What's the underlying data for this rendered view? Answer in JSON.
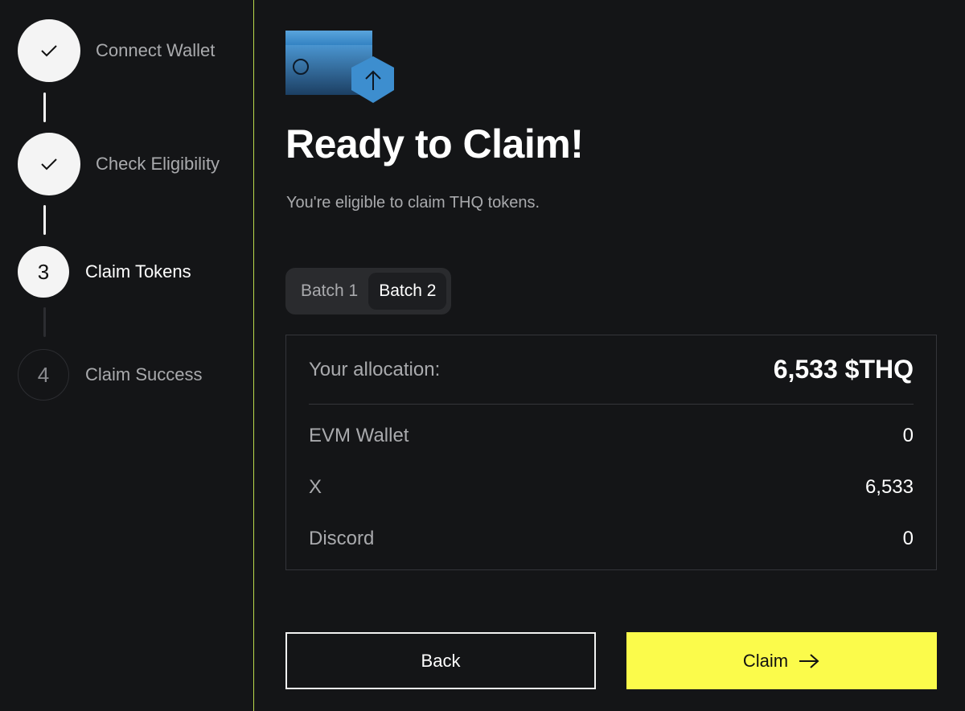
{
  "steps": [
    {
      "label": "Connect Wallet",
      "state": "done",
      "icon": "check-icon"
    },
    {
      "label": "Check Eligibility",
      "state": "done",
      "icon": "check-icon"
    },
    {
      "label": "Claim Tokens",
      "state": "active",
      "number": "3"
    },
    {
      "label": "Claim Success",
      "state": "pending",
      "number": "4"
    }
  ],
  "main": {
    "hero_icon": "wallet-upload-icon",
    "title": "Ready to Claim!",
    "subtitle": "You're eligible to claim THQ tokens.",
    "tabs": [
      {
        "label": "Batch 1",
        "active": false
      },
      {
        "label": "Batch 2",
        "active": true
      }
    ],
    "allocation": {
      "label": "Your allocation:",
      "value": "6,533 $THQ",
      "rows": [
        {
          "label": "EVM Wallet",
          "value": "0"
        },
        {
          "label": "X",
          "value": "6,533"
        },
        {
          "label": "Discord",
          "value": "0"
        }
      ]
    },
    "buttons": {
      "back": "Back",
      "claim": "Claim",
      "claim_icon": "arrow-right-icon"
    }
  },
  "colors": {
    "background": "#141517",
    "accent_yellow": "#fbfb4b",
    "divider_green": "#b8d84a",
    "wallet_blue": "#2f7fc0"
  }
}
